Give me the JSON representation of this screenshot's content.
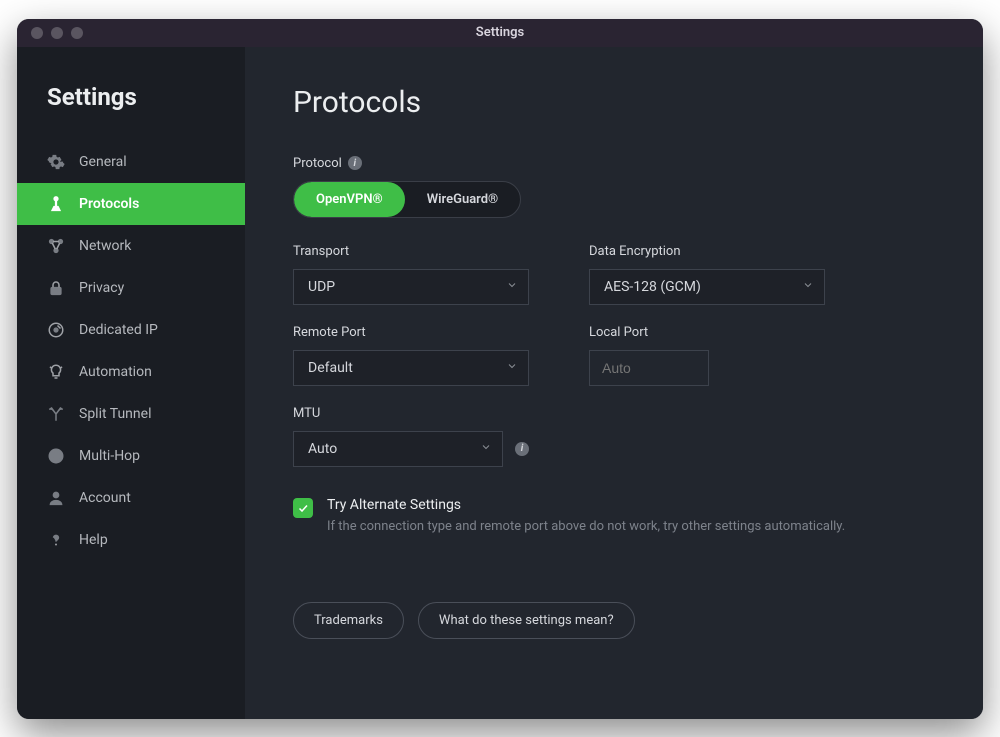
{
  "window": {
    "title": "Settings"
  },
  "sidebar": {
    "heading": "Settings",
    "items": [
      {
        "label": "General",
        "icon": "gear-icon",
        "active": false
      },
      {
        "label": "Protocols",
        "icon": "protocols-icon",
        "active": true
      },
      {
        "label": "Network",
        "icon": "network-icon",
        "active": false
      },
      {
        "label": "Privacy",
        "icon": "lock-icon",
        "active": false
      },
      {
        "label": "Dedicated IP",
        "icon": "dedicated-ip-icon",
        "active": false
      },
      {
        "label": "Automation",
        "icon": "lightbulb-icon",
        "active": false
      },
      {
        "label": "Split Tunnel",
        "icon": "split-tunnel-icon",
        "active": false
      },
      {
        "label": "Multi-Hop",
        "icon": "globe-icon",
        "active": false
      },
      {
        "label": "Account",
        "icon": "account-icon",
        "active": false
      },
      {
        "label": "Help",
        "icon": "help-icon",
        "active": false
      }
    ]
  },
  "main": {
    "title": "Protocols",
    "protocol_label": "Protocol",
    "segmented": {
      "options": [
        "OpenVPN®",
        "WireGuard®"
      ],
      "selected": "OpenVPN®"
    },
    "transport": {
      "label": "Transport",
      "value": "UDP"
    },
    "dataEncryption": {
      "label": "Data Encryption",
      "value": "AES-128 (GCM)"
    },
    "remotePort": {
      "label": "Remote Port",
      "value": "Default"
    },
    "localPort": {
      "label": "Local Port",
      "placeholder": "Auto"
    },
    "mtu": {
      "label": "MTU",
      "value": "Auto"
    },
    "tryAlt": {
      "checked": true,
      "title": "Try Alternate Settings",
      "desc": "If the connection type and remote port above do not work, try other settings automatically."
    },
    "footer": {
      "trademarks": "Trademarks",
      "whatMean": "What do these settings mean?"
    }
  }
}
